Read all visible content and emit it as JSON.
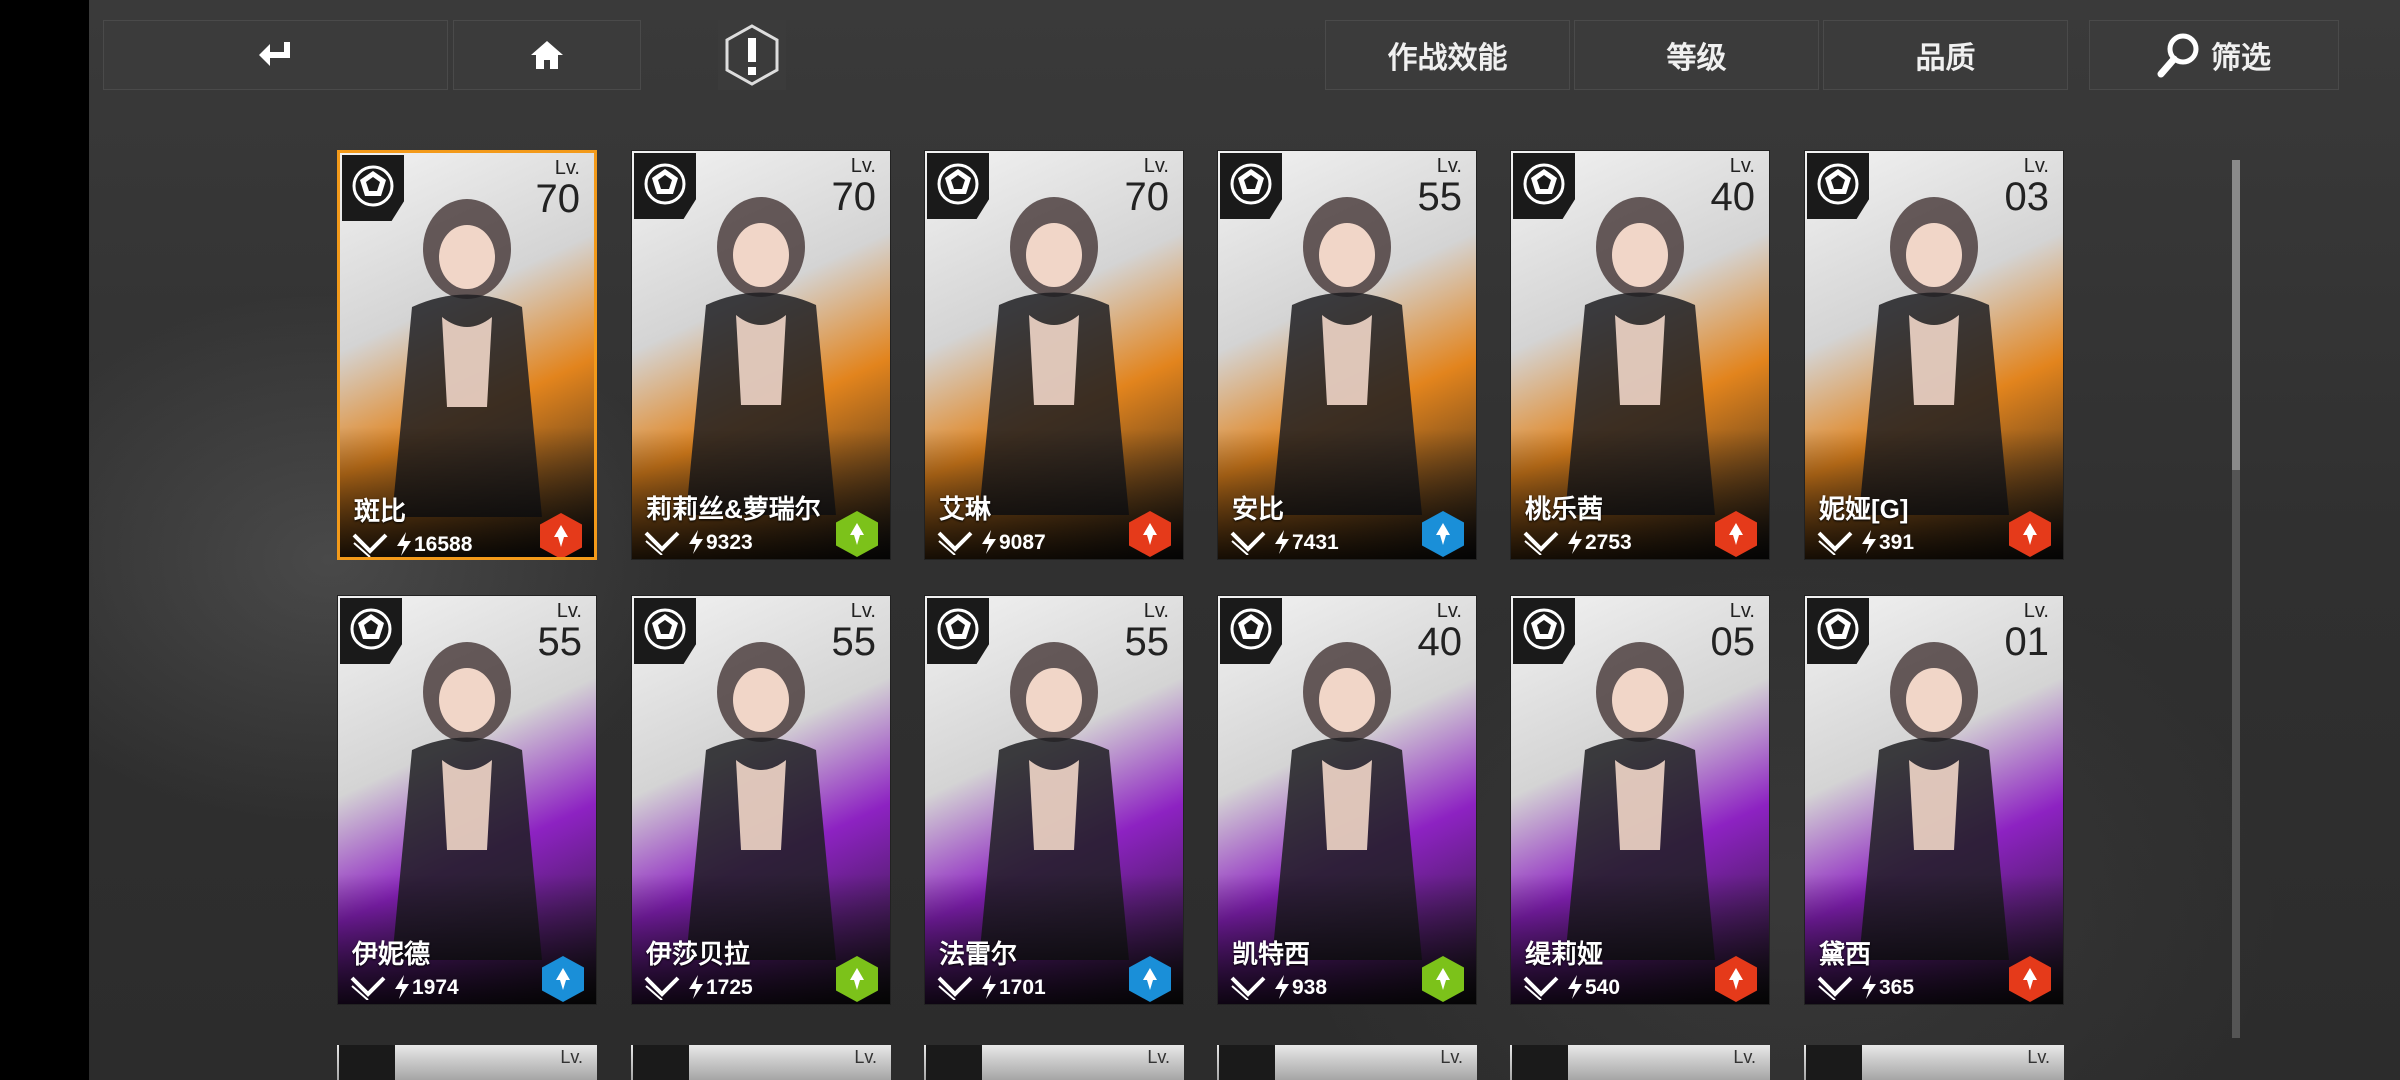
{
  "header": {
    "sort_buttons": [
      "作战效能",
      "等级",
      "品质"
    ],
    "filter_label": "筛选"
  },
  "colors": {
    "selected_border": "#f39a1a",
    "orange_rarity": "#e2841d",
    "purple_rarity": "#8d22c2",
    "element_fire": "#e53a1a",
    "element_nature": "#7cc21a",
    "element_ice": "#1a8fd8"
  },
  "lv_prefix": "Lv.",
  "cards": [
    {
      "name": "斑比",
      "level": "70",
      "power": "16588",
      "rarity": "orange",
      "element": "fire",
      "selected": true
    },
    {
      "name": "莉莉丝&萝瑞尔",
      "level": "70",
      "power": "9323",
      "rarity": "orange",
      "element": "nature",
      "selected": false
    },
    {
      "name": "艾琳",
      "level": "70",
      "power": "9087",
      "rarity": "orange",
      "element": "fire",
      "selected": false
    },
    {
      "name": "安比",
      "level": "55",
      "power": "7431",
      "rarity": "orange",
      "element": "ice",
      "selected": false
    },
    {
      "name": "桃乐茜",
      "level": "40",
      "power": "2753",
      "rarity": "orange",
      "element": "fire",
      "selected": false
    },
    {
      "name": "妮娅[G]",
      "level": "03",
      "power": "391",
      "rarity": "orange",
      "element": "fire",
      "selected": false
    },
    {
      "name": "伊妮德",
      "level": "55",
      "power": "1974",
      "rarity": "purple",
      "element": "ice",
      "selected": false
    },
    {
      "name": "伊莎贝拉",
      "level": "55",
      "power": "1725",
      "rarity": "purple",
      "element": "nature",
      "selected": false
    },
    {
      "name": "法雷尔",
      "level": "55",
      "power": "1701",
      "rarity": "purple",
      "element": "ice",
      "selected": false
    },
    {
      "name": "凯特西",
      "level": "40",
      "power": "938",
      "rarity": "purple",
      "element": "nature",
      "selected": false
    },
    {
      "name": "缇莉娅",
      "level": "05",
      "power": "540",
      "rarity": "purple",
      "element": "fire",
      "selected": false
    },
    {
      "name": "黛西",
      "level": "01",
      "power": "365",
      "rarity": "purple",
      "element": "fire",
      "selected": false
    }
  ]
}
